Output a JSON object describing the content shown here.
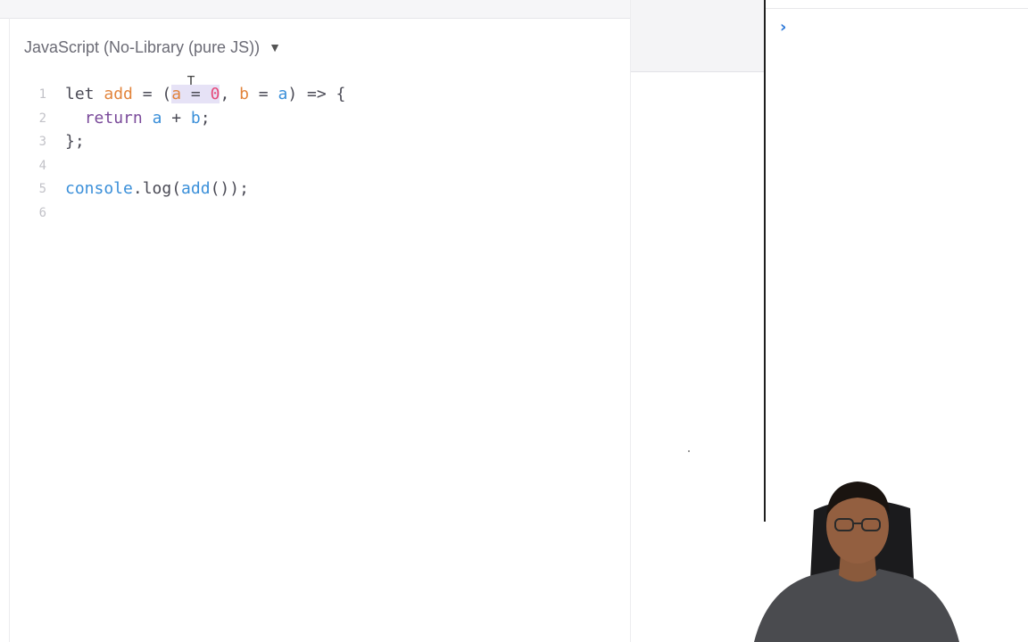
{
  "editor": {
    "language_label": "JavaScript (No-Library (pure JS))",
    "language_caret": "▼",
    "cursor_glyph": "Ｉ",
    "lines": [
      {
        "number": "1",
        "tokens": [
          {
            "text": "let ",
            "cls": "plain"
          },
          {
            "text": "add",
            "cls": "def"
          },
          {
            "text": " = (",
            "cls": "plain"
          },
          {
            "text": "a",
            "cls": "def",
            "sel": true
          },
          {
            "text": " = ",
            "cls": "plain",
            "sel": true
          },
          {
            "text": "0",
            "cls": "num",
            "sel": true
          },
          {
            "text": ", ",
            "cls": "plain"
          },
          {
            "text": "b",
            "cls": "def"
          },
          {
            "text": " = ",
            "cls": "plain"
          },
          {
            "text": "a",
            "cls": "var"
          },
          {
            "text": ") => {",
            "cls": "plain"
          }
        ]
      },
      {
        "number": "2",
        "tokens": [
          {
            "text": "  ",
            "cls": "plain"
          },
          {
            "text": "return",
            "cls": "kw"
          },
          {
            "text": " ",
            "cls": "plain"
          },
          {
            "text": "a",
            "cls": "var"
          },
          {
            "text": " + ",
            "cls": "plain"
          },
          {
            "text": "b",
            "cls": "var"
          },
          {
            "text": ";",
            "cls": "plain"
          }
        ]
      },
      {
        "number": "3",
        "tokens": [
          {
            "text": "};",
            "cls": "plain"
          }
        ]
      },
      {
        "number": "4",
        "tokens": []
      },
      {
        "number": "5",
        "tokens": [
          {
            "text": "console",
            "cls": "var"
          },
          {
            "text": ".log(",
            "cls": "plain"
          },
          {
            "text": "add",
            "cls": "var"
          },
          {
            "text": "());",
            "cls": "plain"
          }
        ]
      },
      {
        "number": "6",
        "tokens": []
      }
    ]
  },
  "console": {
    "prompt_glyph": "›"
  },
  "colors": {
    "keyword": "#7a4a9a",
    "definition": "#e2843c",
    "variable": "#3a8fd9",
    "number": "#e64a7a",
    "selection": "#e6e2f6",
    "console_prompt": "#2f7ad9"
  }
}
